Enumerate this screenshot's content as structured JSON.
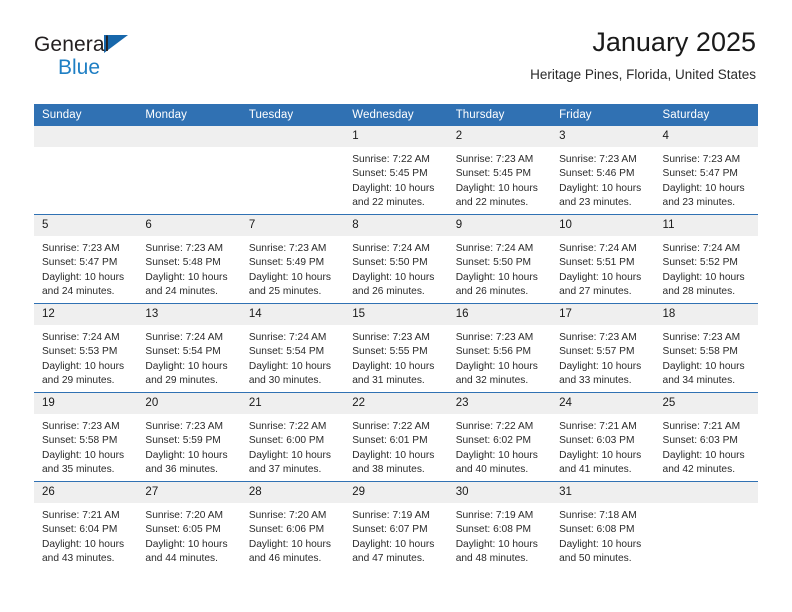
{
  "brand": {
    "name_part1": "General",
    "name_part2": "Blue",
    "logo_icon": "blue-triangle-icon"
  },
  "header": {
    "title": "January 2025",
    "location": "Heritage Pines, Florida, United States"
  },
  "colors": {
    "header_blue": "#3071b3",
    "brand_blue": "#1f7fc4",
    "daynum_band": "#efefef",
    "text": "#2a2a2a"
  },
  "labels": {
    "sunrise_prefix": "Sunrise:",
    "sunset_prefix": "Sunset:",
    "daylight_prefix": "Daylight:"
  },
  "weekday_headers": [
    "Sunday",
    "Monday",
    "Tuesday",
    "Wednesday",
    "Thursday",
    "Friday",
    "Saturday"
  ],
  "weeks": [
    [
      {
        "day": "",
        "blank": true,
        "sunrise": "",
        "sunset": "",
        "daylight_line1": "",
        "daylight_line2": ""
      },
      {
        "day": "",
        "blank": true,
        "sunrise": "",
        "sunset": "",
        "daylight_line1": "",
        "daylight_line2": ""
      },
      {
        "day": "",
        "blank": true,
        "sunrise": "",
        "sunset": "",
        "daylight_line1": "",
        "daylight_line2": ""
      },
      {
        "day": "1",
        "blank": false,
        "sunrise": "Sunrise: 7:22 AM",
        "sunset": "Sunset: 5:45 PM",
        "daylight_line1": "Daylight: 10 hours",
        "daylight_line2": "and 22 minutes."
      },
      {
        "day": "2",
        "blank": false,
        "sunrise": "Sunrise: 7:23 AM",
        "sunset": "Sunset: 5:45 PM",
        "daylight_line1": "Daylight: 10 hours",
        "daylight_line2": "and 22 minutes."
      },
      {
        "day": "3",
        "blank": false,
        "sunrise": "Sunrise: 7:23 AM",
        "sunset": "Sunset: 5:46 PM",
        "daylight_line1": "Daylight: 10 hours",
        "daylight_line2": "and 23 minutes."
      },
      {
        "day": "4",
        "blank": false,
        "sunrise": "Sunrise: 7:23 AM",
        "sunset": "Sunset: 5:47 PM",
        "daylight_line1": "Daylight: 10 hours",
        "daylight_line2": "and 23 minutes."
      }
    ],
    [
      {
        "day": "5",
        "blank": false,
        "sunrise": "Sunrise: 7:23 AM",
        "sunset": "Sunset: 5:47 PM",
        "daylight_line1": "Daylight: 10 hours",
        "daylight_line2": "and 24 minutes."
      },
      {
        "day": "6",
        "blank": false,
        "sunrise": "Sunrise: 7:23 AM",
        "sunset": "Sunset: 5:48 PM",
        "daylight_line1": "Daylight: 10 hours",
        "daylight_line2": "and 24 minutes."
      },
      {
        "day": "7",
        "blank": false,
        "sunrise": "Sunrise: 7:23 AM",
        "sunset": "Sunset: 5:49 PM",
        "daylight_line1": "Daylight: 10 hours",
        "daylight_line2": "and 25 minutes."
      },
      {
        "day": "8",
        "blank": false,
        "sunrise": "Sunrise: 7:24 AM",
        "sunset": "Sunset: 5:50 PM",
        "daylight_line1": "Daylight: 10 hours",
        "daylight_line2": "and 26 minutes."
      },
      {
        "day": "9",
        "blank": false,
        "sunrise": "Sunrise: 7:24 AM",
        "sunset": "Sunset: 5:50 PM",
        "daylight_line1": "Daylight: 10 hours",
        "daylight_line2": "and 26 minutes."
      },
      {
        "day": "10",
        "blank": false,
        "sunrise": "Sunrise: 7:24 AM",
        "sunset": "Sunset: 5:51 PM",
        "daylight_line1": "Daylight: 10 hours",
        "daylight_line2": "and 27 minutes."
      },
      {
        "day": "11",
        "blank": false,
        "sunrise": "Sunrise: 7:24 AM",
        "sunset": "Sunset: 5:52 PM",
        "daylight_line1": "Daylight: 10 hours",
        "daylight_line2": "and 28 minutes."
      }
    ],
    [
      {
        "day": "12",
        "blank": false,
        "sunrise": "Sunrise: 7:24 AM",
        "sunset": "Sunset: 5:53 PM",
        "daylight_line1": "Daylight: 10 hours",
        "daylight_line2": "and 29 minutes."
      },
      {
        "day": "13",
        "blank": false,
        "sunrise": "Sunrise: 7:24 AM",
        "sunset": "Sunset: 5:54 PM",
        "daylight_line1": "Daylight: 10 hours",
        "daylight_line2": "and 29 minutes."
      },
      {
        "day": "14",
        "blank": false,
        "sunrise": "Sunrise: 7:24 AM",
        "sunset": "Sunset: 5:54 PM",
        "daylight_line1": "Daylight: 10 hours",
        "daylight_line2": "and 30 minutes."
      },
      {
        "day": "15",
        "blank": false,
        "sunrise": "Sunrise: 7:23 AM",
        "sunset": "Sunset: 5:55 PM",
        "daylight_line1": "Daylight: 10 hours",
        "daylight_line2": "and 31 minutes."
      },
      {
        "day": "16",
        "blank": false,
        "sunrise": "Sunrise: 7:23 AM",
        "sunset": "Sunset: 5:56 PM",
        "daylight_line1": "Daylight: 10 hours",
        "daylight_line2": "and 32 minutes."
      },
      {
        "day": "17",
        "blank": false,
        "sunrise": "Sunrise: 7:23 AM",
        "sunset": "Sunset: 5:57 PM",
        "daylight_line1": "Daylight: 10 hours",
        "daylight_line2": "and 33 minutes."
      },
      {
        "day": "18",
        "blank": false,
        "sunrise": "Sunrise: 7:23 AM",
        "sunset": "Sunset: 5:58 PM",
        "daylight_line1": "Daylight: 10 hours",
        "daylight_line2": "and 34 minutes."
      }
    ],
    [
      {
        "day": "19",
        "blank": false,
        "sunrise": "Sunrise: 7:23 AM",
        "sunset": "Sunset: 5:58 PM",
        "daylight_line1": "Daylight: 10 hours",
        "daylight_line2": "and 35 minutes."
      },
      {
        "day": "20",
        "blank": false,
        "sunrise": "Sunrise: 7:23 AM",
        "sunset": "Sunset: 5:59 PM",
        "daylight_line1": "Daylight: 10 hours",
        "daylight_line2": "and 36 minutes."
      },
      {
        "day": "21",
        "blank": false,
        "sunrise": "Sunrise: 7:22 AM",
        "sunset": "Sunset: 6:00 PM",
        "daylight_line1": "Daylight: 10 hours",
        "daylight_line2": "and 37 minutes."
      },
      {
        "day": "22",
        "blank": false,
        "sunrise": "Sunrise: 7:22 AM",
        "sunset": "Sunset: 6:01 PM",
        "daylight_line1": "Daylight: 10 hours",
        "daylight_line2": "and 38 minutes."
      },
      {
        "day": "23",
        "blank": false,
        "sunrise": "Sunrise: 7:22 AM",
        "sunset": "Sunset: 6:02 PM",
        "daylight_line1": "Daylight: 10 hours",
        "daylight_line2": "and 40 minutes."
      },
      {
        "day": "24",
        "blank": false,
        "sunrise": "Sunrise: 7:21 AM",
        "sunset": "Sunset: 6:03 PM",
        "daylight_line1": "Daylight: 10 hours",
        "daylight_line2": "and 41 minutes."
      },
      {
        "day": "25",
        "blank": false,
        "sunrise": "Sunrise: 7:21 AM",
        "sunset": "Sunset: 6:03 PM",
        "daylight_line1": "Daylight: 10 hours",
        "daylight_line2": "and 42 minutes."
      }
    ],
    [
      {
        "day": "26",
        "blank": false,
        "sunrise": "Sunrise: 7:21 AM",
        "sunset": "Sunset: 6:04 PM",
        "daylight_line1": "Daylight: 10 hours",
        "daylight_line2": "and 43 minutes."
      },
      {
        "day": "27",
        "blank": false,
        "sunrise": "Sunrise: 7:20 AM",
        "sunset": "Sunset: 6:05 PM",
        "daylight_line1": "Daylight: 10 hours",
        "daylight_line2": "and 44 minutes."
      },
      {
        "day": "28",
        "blank": false,
        "sunrise": "Sunrise: 7:20 AM",
        "sunset": "Sunset: 6:06 PM",
        "daylight_line1": "Daylight: 10 hours",
        "daylight_line2": "and 46 minutes."
      },
      {
        "day": "29",
        "blank": false,
        "sunrise": "Sunrise: 7:19 AM",
        "sunset": "Sunset: 6:07 PM",
        "daylight_line1": "Daylight: 10 hours",
        "daylight_line2": "and 47 minutes."
      },
      {
        "day": "30",
        "blank": false,
        "sunrise": "Sunrise: 7:19 AM",
        "sunset": "Sunset: 6:08 PM",
        "daylight_line1": "Daylight: 10 hours",
        "daylight_line2": "and 48 minutes."
      },
      {
        "day": "31",
        "blank": false,
        "sunrise": "Sunrise: 7:18 AM",
        "sunset": "Sunset: 6:08 PM",
        "daylight_line1": "Daylight: 10 hours",
        "daylight_line2": "and 50 minutes."
      },
      {
        "day": "",
        "blank": true,
        "sunrise": "",
        "sunset": "",
        "daylight_line1": "",
        "daylight_line2": ""
      }
    ]
  ]
}
